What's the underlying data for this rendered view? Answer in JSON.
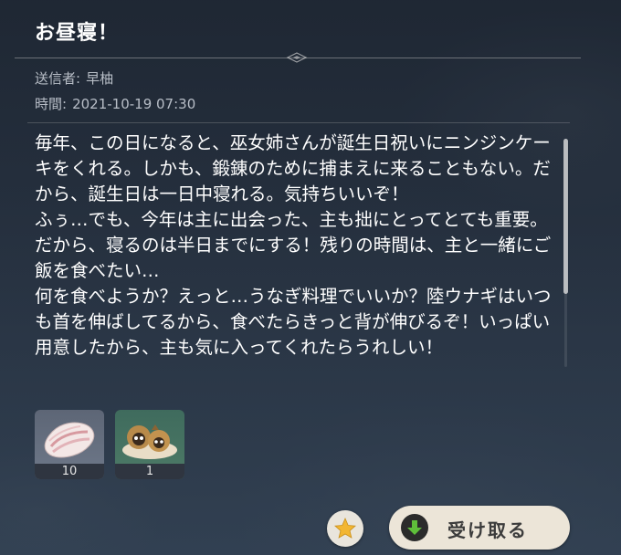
{
  "mail": {
    "title": "お昼寝！",
    "sender_label": "送信者:",
    "sender_name": "早柚",
    "time_label": "時間:",
    "time_value": "2021-10-19 07:30",
    "body": "毎年、この日になると、巫女姉さんが誕生日祝いにニンジンケーキをくれる。しかも、鍛錬のために捕まえに来ることもない。だから、誕生日は一日中寝れる。気持ちいいぞ！\nふぅ…でも、今年は主に出会った、主も拙にとってとても重要。だから、寝るのは半日までにする！残りの時間は、主と一緒にご飯を食べたい…\n何を食べようか？えっと…うなぎ料理でいいか？陸ウナギはいつも首を伸ばしてるから、食べたらきっと背が伸びるぞ！いっぱい用意したから、主も気に入ってくれたらうれしい！"
  },
  "attachments": [
    {
      "icon": "raw-meat-icon",
      "count": "10"
    },
    {
      "icon": "tanuki-dish-icon",
      "count": "1"
    }
  ],
  "actions": {
    "star_icon": "star-icon",
    "claim_label": "受け取る",
    "claim_icon": "download-arrow-icon"
  },
  "colors": {
    "claim_button_bg": "#ece5d8",
    "star_color": "#f2b632",
    "claim_icon_arrow": "#5fbf3a"
  }
}
